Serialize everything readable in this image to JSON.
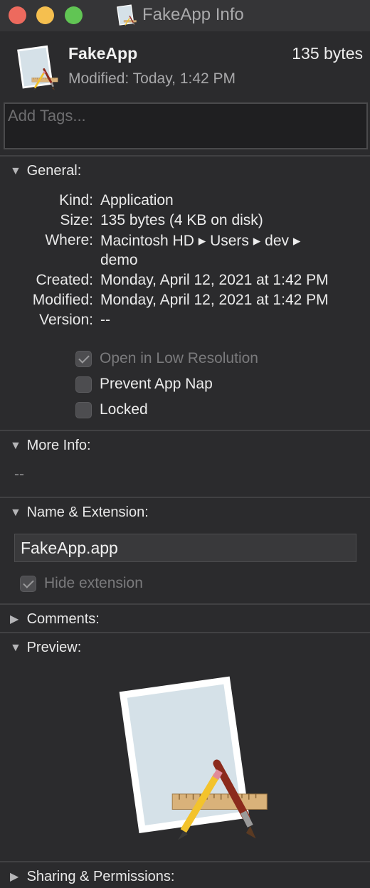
{
  "window": {
    "title": "FakeApp Info",
    "controls": [
      "close",
      "minimize",
      "zoom"
    ]
  },
  "header": {
    "icon": "app-bundle-icon",
    "name": "FakeApp",
    "size": "135 bytes",
    "modified": "Modified: Today, 1:42 PM"
  },
  "tags": {
    "placeholder": "Add Tags..."
  },
  "general": {
    "label": "General:",
    "expanded": true,
    "rows": [
      {
        "key": "Kind:",
        "value": "Application"
      },
      {
        "key": "Size:",
        "value": "135 bytes (4 KB on disk)"
      },
      {
        "key": "Where:",
        "value": "Macintosh HD ▸ Users ▸ dev ▸",
        "value2": "demo"
      },
      {
        "key": "Created:",
        "value": "Monday, April 12, 2021 at 1:42 PM"
      },
      {
        "key": "Modified:",
        "value": "Monday, April 12, 2021 at 1:42 PM"
      },
      {
        "key": "Version:",
        "value": "--"
      }
    ],
    "checkboxes": [
      {
        "label": "Open in Low Resolution",
        "checked": true,
        "enabled": false
      },
      {
        "label": "Prevent App Nap",
        "checked": false,
        "enabled": true
      },
      {
        "label": "Locked",
        "checked": false,
        "enabled": true
      }
    ]
  },
  "more_info": {
    "label": "More Info:",
    "expanded": true,
    "value": "--"
  },
  "name_extension": {
    "label": "Name & Extension:",
    "expanded": true,
    "value": "FakeApp.app",
    "hide_extension": {
      "label": "Hide extension",
      "checked": true,
      "enabled": false
    }
  },
  "comments": {
    "label": "Comments:",
    "expanded": false
  },
  "preview": {
    "label": "Preview:",
    "expanded": true,
    "icon": "app-bundle-icon"
  },
  "sharing": {
    "label": "Sharing & Permissions:",
    "expanded": false
  },
  "colors": {
    "background": "#2b2b2d",
    "titlebar": "#353537",
    "close": "#ed6a5e",
    "minimize": "#f5bf4f",
    "zoom": "#61c554"
  }
}
